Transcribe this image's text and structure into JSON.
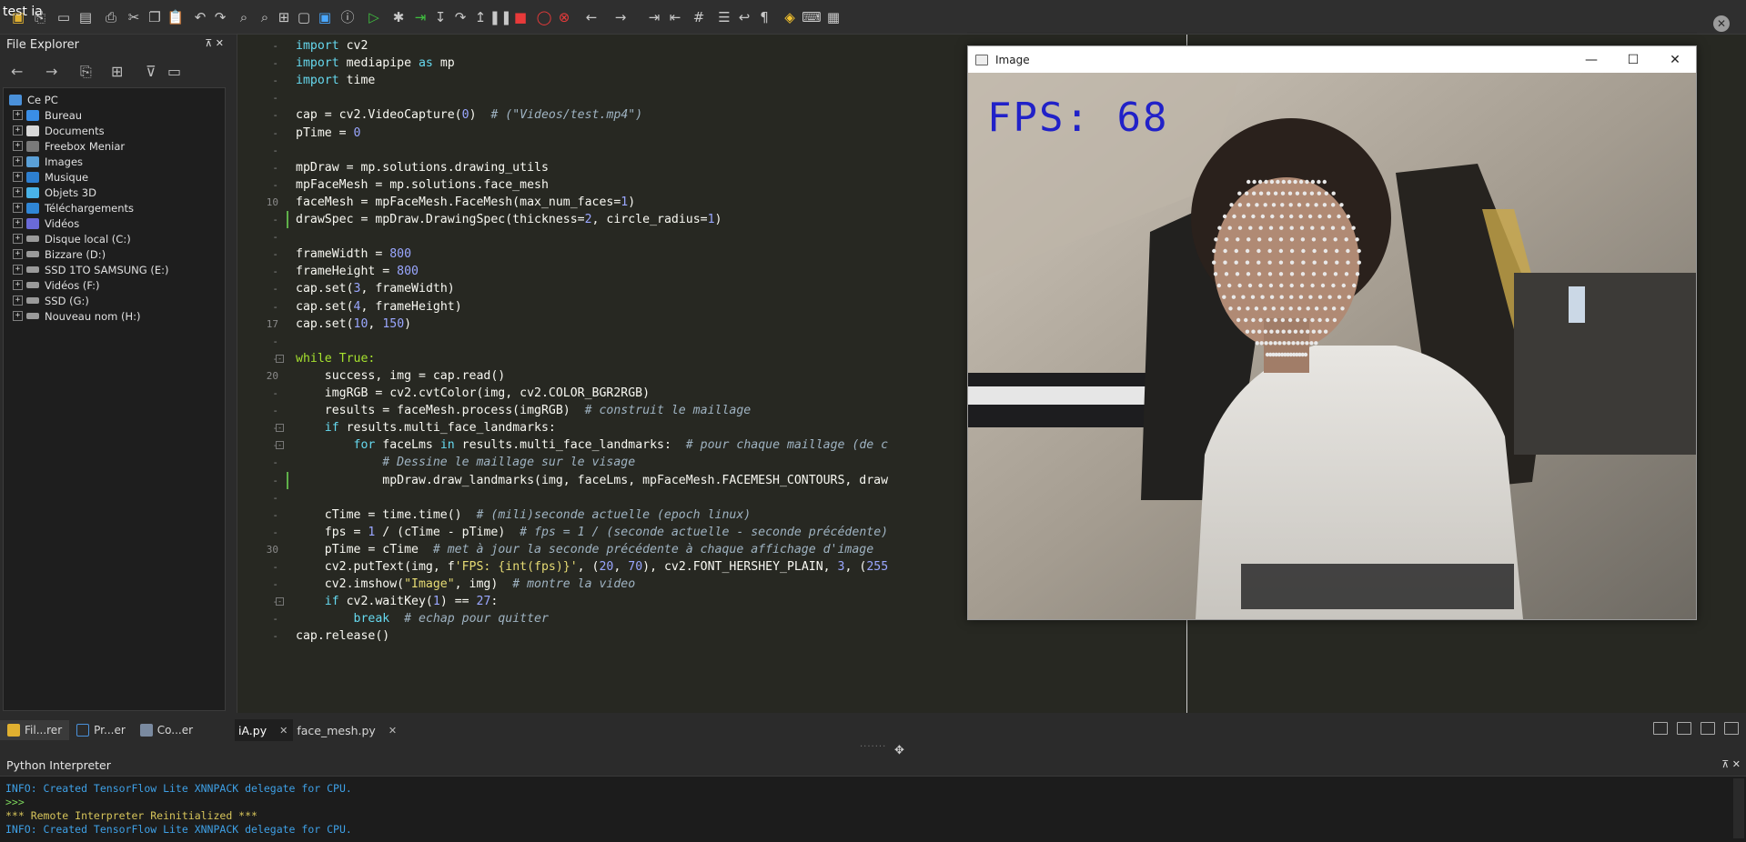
{
  "app": {
    "title": "test ia"
  },
  "toolbar": {
    "icons": [
      "new-file-icon",
      "open-icon",
      "save-icon",
      "save-all-icon",
      "print-icon",
      "cut-icon",
      "copy-icon",
      "paste-icon",
      "undo-icon",
      "redo-icon",
      "find-icon",
      "find-replace-icon",
      "find-in-files-icon",
      "screenshot-icon",
      "terminal-icon",
      "info-icon",
      "run-icon",
      "debug-icon",
      "run-to-cursor-icon",
      "step-into-icon",
      "step-over-icon",
      "step-out-icon",
      "pause-icon",
      "stop-icon",
      "breakpoint-icon",
      "clear-breakpoints-icon",
      "back-icon",
      "forward-icon",
      "indent-icon",
      "dedent-icon",
      "comment-icon",
      "list-icon",
      "wrap-icon",
      "pilcrow-icon",
      "python-icon",
      "keyboard-icon",
      "layout-icon"
    ]
  },
  "explorer": {
    "title": "File Explorer",
    "root": "Ce PC",
    "items": [
      {
        "label": "Bureau",
        "icon": "folder-blue"
      },
      {
        "label": "Documents",
        "icon": "document-folder"
      },
      {
        "label": "Freebox Meniar",
        "icon": "network-drive"
      },
      {
        "label": "Images",
        "icon": "images-folder"
      },
      {
        "label": "Musique",
        "icon": "music-folder"
      },
      {
        "label": "Objets 3D",
        "icon": "objects3d-folder"
      },
      {
        "label": "Téléchargements",
        "icon": "downloads-folder"
      },
      {
        "label": "Vidéos",
        "icon": "videos-folder"
      },
      {
        "label": "Disque local (C:)",
        "icon": "drive"
      },
      {
        "label": "Bizzare (D:)",
        "icon": "drive"
      },
      {
        "label": "SSD 1TO SAMSUNG (E:)",
        "icon": "drive"
      },
      {
        "label": "Vidéos (F:)",
        "icon": "drive"
      },
      {
        "label": "SSD (G:)",
        "icon": "drive"
      },
      {
        "label": "Nouveau nom (H:)",
        "icon": "drive"
      }
    ]
  },
  "left_tabs": [
    {
      "label": "Fil...rer"
    },
    {
      "label": "Pr...er"
    },
    {
      "label": "Co...er"
    }
  ],
  "editor": {
    "tabs": [
      {
        "label": "iA.py",
        "close": "✕"
      },
      {
        "label": "face_mesh.py",
        "close": "✕"
      }
    ],
    "line_numbers": {
      "l10": "10",
      "l17": "17",
      "l20": "20",
      "l30": "30"
    },
    "code": {
      "c1a": "import",
      "c1b": " cv2",
      "c2a": "import",
      "c2b": " mediapipe ",
      "c2c": "as",
      "c2d": " mp",
      "c3a": "import",
      "c3b": " time",
      "c5a": "cap = cv2.VideoCapture(",
      "c5b": "0",
      "c5c": ")  ",
      "c5d": "# (\"Videos/test.mp4\")",
      "c6a": "pTime = ",
      "c6b": "0",
      "c8": "mpDraw = mp.solutions.drawing_utils",
      "c9": "mpFaceMesh = mp.solutions.face_mesh",
      "c10a": "faceMesh = mpFaceMesh.FaceMesh(max_num_faces=",
      "c10b": "1",
      "c10c": ")",
      "c11a": "drawSpec = mpDraw.DrawingSpec(thickness=",
      "c11b": "2",
      "c11c": ", circle_radius=",
      "c11d": "1",
      "c11e": ")",
      "c13a": "frameWidth = ",
      "c13b": "800",
      "c14a": "frameHeight = ",
      "c14b": "800",
      "c15a": "cap.set(",
      "c15b": "3",
      "c15c": ", frameWidth)",
      "c16a": "cap.set(",
      "c16b": "4",
      "c16c": ", frameHeight)",
      "c17a": "cap.set(",
      "c17b": "10",
      "c17c": ", ",
      "c17d": "150",
      "c17e": ")",
      "c19a": "while",
      "c19b": " True:",
      "c20": "    success, img = cap.read()",
      "c21": "    imgRGB = cv2.cvtColor(img, cv2.COLOR_BGR2RGB)",
      "c22a": "    results = faceMesh.process(imgRGB)  ",
      "c22b": "# construit le maillage",
      "c23a": "    ",
      "c23b": "if",
      "c23c": " results.multi_face_landmarks:",
      "c24a": "        ",
      "c24b": "for",
      "c24c": " faceLms ",
      "c24d": "in",
      "c24e": " results.multi_face_landmarks:  ",
      "c24f": "# pour chaque maillage (de c",
      "c25": "            # Dessine le maillage sur le visage",
      "c26": "            mpDraw.draw_landmarks(img, faceLms, mpFaceMesh.FACEMESH_CONTOURS, draw",
      "c28a": "    cTime = time.time()  ",
      "c28b": "# (mili)seconde actuelle (epoch linux)",
      "c29a": "    fps = ",
      "c29b": "1",
      "c29c": " / (cTime - pTime)  ",
      "c29d": "# fps = 1 / (seconde actuelle - seconde précédente)",
      "c30a": "    pTime = cTime  ",
      "c30b": "# met à jour la seconde précédente à chaque affichage d'image",
      "c31a": "    cv2.putText(img, f",
      "c31b": "'FPS: {int(fps)}'",
      "c31c": ", (",
      "c31d": "20",
      "c31e": ", ",
      "c31f": "70",
      "c31g": "), cv2.FONT_HERSHEY_PLAIN, ",
      "c31h": "3",
      "c31i": ", (",
      "c31j": "255",
      "c32a": "    cv2.imshow(",
      "c32b": "\"Image\"",
      "c32c": ", img)  ",
      "c32d": "# montre la video",
      "c33a": "    ",
      "c33b": "if",
      "c33c": " cv2.waitKey(",
      "c33d": "1",
      "c33e": ") == ",
      "c33f": "27",
      "c33g": ":",
      "c34a": "        ",
      "c34b": "break",
      "c34c": "  ",
      "c34d": "# echap pour quitter",
      "c35": "cap.release()"
    }
  },
  "image_window": {
    "title": "Image",
    "fps_text": "FPS: 68",
    "minimize": "—",
    "maximize": "☐",
    "close": "✕"
  },
  "interpreter": {
    "title": "Python Interpreter",
    "lines": [
      "INFO: Created TensorFlow Lite XNNPACK delegate for CPU.",
      ">>>",
      "*** Remote Interpreter Reinitialized ***",
      "INFO: Created TensorFlow Lite XNNPACK delegate for CPU."
    ]
  },
  "colors": {
    "editor_bg": "#272822",
    "keyword": "#66d9ef",
    "number": "#9aa7ff",
    "string": "#e6db74",
    "comment": "#9fb3c2",
    "info": "#3ea0e6",
    "fps_text": "#2121c8"
  }
}
